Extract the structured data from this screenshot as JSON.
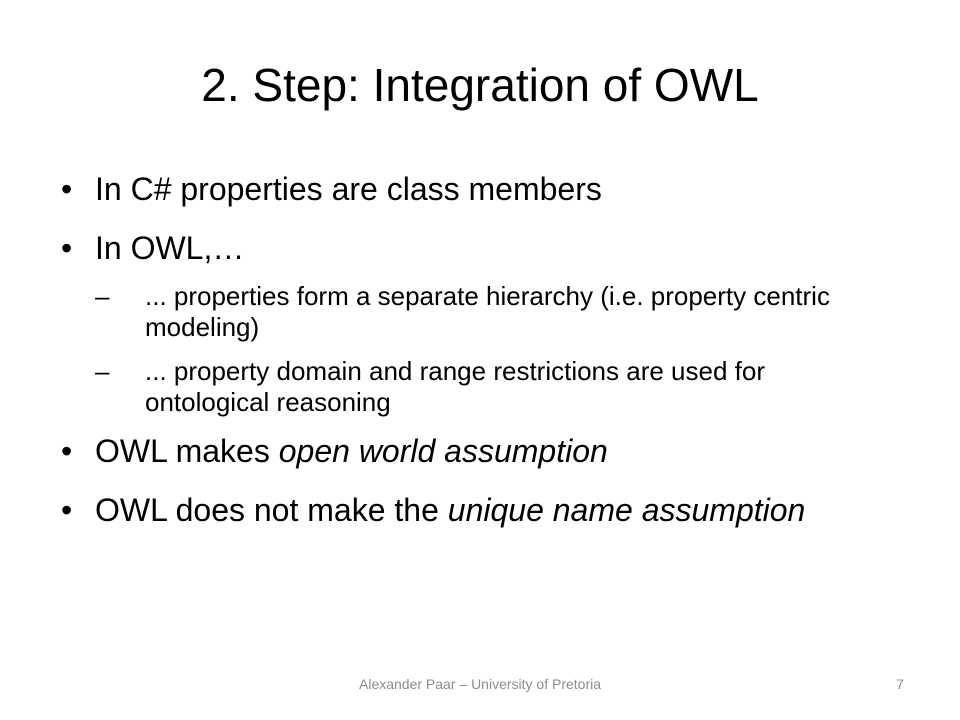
{
  "slide": {
    "title": "2. Step: Integration of OWL",
    "bullet_char": "•",
    "dash_char": "–",
    "bullets": [
      {
        "text": "In C# properties are class members"
      },
      {
        "text": "In OWL,…",
        "subbullets": [
          "... properties form a separate hierarchy (i.e. property centric modeling)",
          "... property domain and range restrictions are used for ontological reasoning"
        ]
      },
      {
        "text_plain": "OWL makes ",
        "text_italic": "open world assumption"
      },
      {
        "text_plain": "OWL does not make the ",
        "text_italic": "unique name assumption"
      }
    ],
    "footer": "Alexander Paar – University of Pretoria",
    "page_number": "7"
  }
}
